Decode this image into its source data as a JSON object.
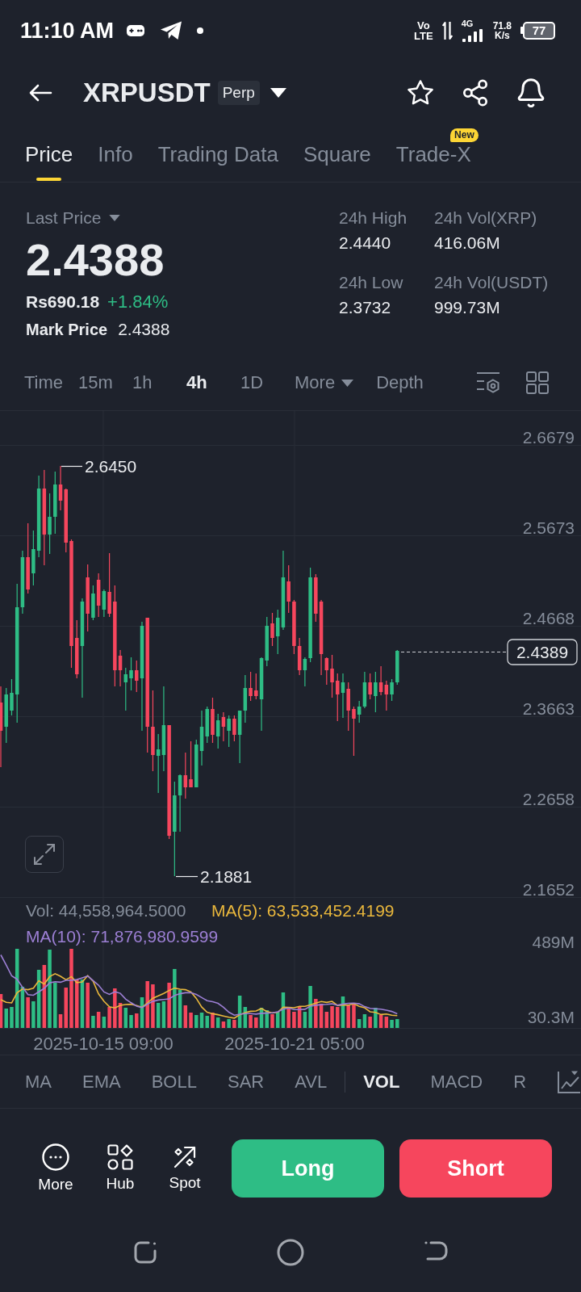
{
  "status_bar": {
    "time": "11:10 AM",
    "volte": [
      "Vo",
      "LTE"
    ],
    "network": "4G",
    "speed": [
      "71.8",
      "K/s"
    ],
    "battery": "77"
  },
  "header": {
    "symbol": "XRPUSDT",
    "badge": "Perp"
  },
  "tabs": [
    {
      "label": "Price",
      "selected": true
    },
    {
      "label": "Info",
      "selected": false
    },
    {
      "label": "Trading Data",
      "selected": false
    },
    {
      "label": "Square",
      "selected": false
    },
    {
      "label": "Trade-X",
      "selected": false,
      "badge": "New"
    }
  ],
  "price_panel": {
    "last_price_label": "Last Price",
    "last_price": "2.4388",
    "fiat_price": "Rs690.18",
    "change": "+1.84%",
    "mark_price_label": "Mark Price",
    "mark_price": "2.4388",
    "stats": [
      {
        "label": "24h High",
        "value": "2.4440"
      },
      {
        "label": "24h Vol(XRP)",
        "value": "416.06M"
      },
      {
        "label": "24h Low",
        "value": "2.3732"
      },
      {
        "label": "24h Vol(USDT)",
        "value": "999.73M"
      }
    ]
  },
  "intervals": [
    {
      "label": "Time",
      "kind": "plain",
      "selected": false
    },
    {
      "label": "15m",
      "kind": "plain",
      "selected": false
    },
    {
      "label": "1h",
      "kind": "plain",
      "selected": false
    },
    {
      "label": "4h",
      "kind": "plain",
      "selected": true
    },
    {
      "label": "1D",
      "kind": "plain",
      "selected": false
    },
    {
      "label": "More",
      "kind": "menu",
      "selected": false
    },
    {
      "label": "Depth",
      "kind": "plain",
      "selected": false
    }
  ],
  "chart": {
    "y_axis": [
      "2.6679",
      "2.5673",
      "2.4668",
      "2.3663",
      "2.2658",
      "2.1652"
    ],
    "high_marker": "2.6450",
    "low_marker": "2.1881",
    "current_price": "2.4389",
    "x_axis": [
      "2025-10-15 09:00",
      "2025-10-21 05:00"
    ]
  },
  "volume": {
    "reading": "Vol: 44,558,964.5000",
    "averages": [
      {
        "text": "MA(5): 63,533,452.4199",
        "color": "#e9b73c"
      },
      {
        "text": "MA(10): 71,876,980.9599",
        "color": "#9c7fd4"
      }
    ],
    "y_axis": [
      "489M",
      "30.3M"
    ]
  },
  "indicators": {
    "main": [
      {
        "label": "MA",
        "selected": false
      },
      {
        "label": "EMA",
        "selected": false
      },
      {
        "label": "BOLL",
        "selected": false
      },
      {
        "label": "SAR",
        "selected": false
      },
      {
        "label": "AVL",
        "selected": false
      }
    ],
    "sub": [
      {
        "label": "VOL",
        "selected": true
      },
      {
        "label": "MACD",
        "selected": false
      },
      {
        "label": "R",
        "selected": false
      }
    ]
  },
  "actions": [
    {
      "label": "More"
    },
    {
      "label": "Hub"
    },
    {
      "label": "Spot"
    }
  ],
  "trade_buttons": [
    {
      "label": "Long",
      "kind": "long"
    },
    {
      "label": "Short",
      "kind": "short"
    }
  ]
}
